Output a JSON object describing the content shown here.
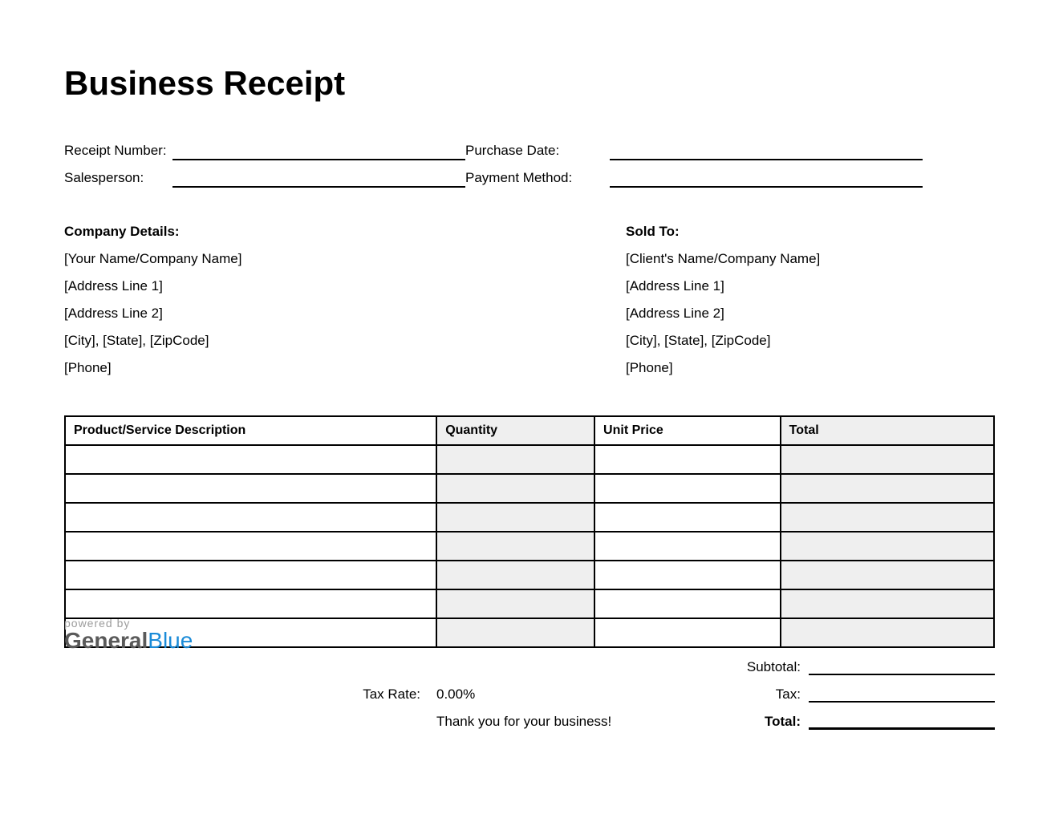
{
  "title": "Business Receipt",
  "meta": {
    "receipt_number_label": "Receipt Number:",
    "purchase_date_label": "Purchase Date:",
    "salesperson_label": "Salesperson:",
    "payment_method_label": "Payment Method:"
  },
  "company": {
    "heading": "Company Details:",
    "name": "[Your Name/Company Name]",
    "addr1": "[Address Line 1]",
    "addr2": "[Address Line 2]",
    "city": "[City], [State], [ZipCode]",
    "phone": "[Phone]"
  },
  "soldto": {
    "heading": "Sold To:",
    "name": "[Client's Name/Company Name]",
    "addr1": "[Address Line 1]",
    "addr2": "[Address Line 2]",
    "city": "[City], [State], [ZipCode]",
    "phone": "[Phone]"
  },
  "table": {
    "headers": {
      "desc": "Product/Service Description",
      "qty": "Quantity",
      "unit": "Unit Price",
      "total": "Total"
    }
  },
  "totals": {
    "subtotal_label": "Subtotal:",
    "tax_rate_label": "Tax Rate:",
    "tax_rate_value": "0.00%",
    "tax_label": "Tax:",
    "total_label": "Total:"
  },
  "thankyou": "Thank you for your business!",
  "footer": {
    "powered": "powered by",
    "general": "General",
    "blue": "Blue"
  }
}
